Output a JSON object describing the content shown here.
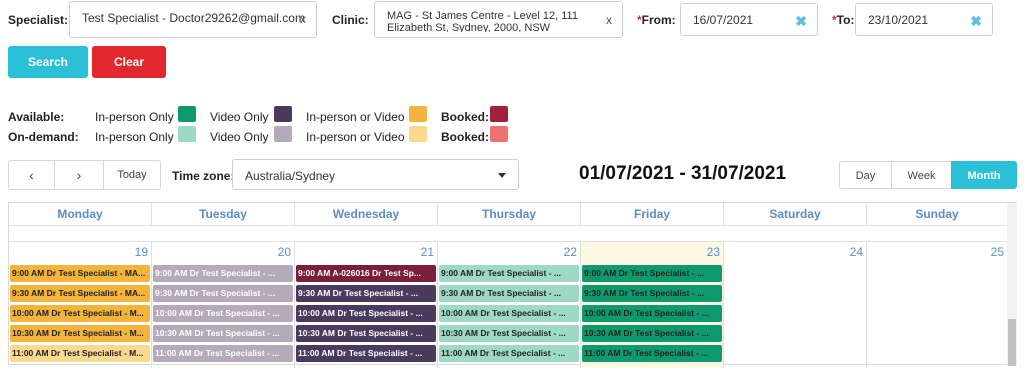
{
  "filters": {
    "specialist_label": "Specialist:",
    "specialist_value": "Test Specialist - Doctor29262@gmail.com",
    "clinic_label": "Clinic:",
    "clinic_value_line1": "MAG - St James Centre - Level 12, 111",
    "clinic_value_line2": "Elizabeth St, Sydney, 2000, NSW",
    "from_label": "From:",
    "from_value": "16/07/2021",
    "to_label": "To:",
    "to_value": "23/10/2021",
    "clear_x": "x",
    "clear_icon": "✖"
  },
  "actions": {
    "search_label": "Search",
    "clear_label": "Clear"
  },
  "legend": {
    "available_label": "Available:",
    "ondemand_label": "On-demand:",
    "inperson_only": "In-person Only",
    "video_only": "Video Only",
    "inperson_or_video": "In-person or Video",
    "booked": "Booked:",
    "colors": {
      "avail_inperson": "#0f9a6e",
      "avail_video": "#4a3b5e",
      "avail_either": "#f3b43c",
      "avail_booked": "#a1213a",
      "od_inperson": "#9ed9c6",
      "od_video": "#b4aab9",
      "od_either": "#fbd98e",
      "od_booked": "#f07070"
    }
  },
  "toolbar": {
    "prev": "‹",
    "next": "›",
    "today": "Today",
    "timezone_label": "Time zone:",
    "timezone_value": "Australia/Sydney",
    "range_title": "01/07/2021 - 31/07/2021",
    "views": [
      "Day",
      "Week",
      "Month"
    ],
    "active_view": "Month"
  },
  "calendar": {
    "weekdays": [
      "Monday",
      "Tuesday",
      "Wednesday",
      "Thursday",
      "Friday",
      "Saturday",
      "Sunday"
    ],
    "days": [
      "19",
      "20",
      "21",
      "22",
      "23",
      "24",
      "25"
    ],
    "events": {
      "mon": [
        "9:00 AM Dr Test Specialist - MA...",
        "9:30 AM Dr Test Specialist - MA...",
        "10:00 AM Dr Test Specialist - M...",
        "10:30 AM Dr Test Specialist - M...",
        "11:00 AM Dr Test Specialist - M..."
      ],
      "tue": [
        "9:00 AM Dr Test Specialist - ...",
        "9:30 AM Dr Test Specialist - ...",
        "10:00 AM Dr Test Specialist - ...",
        "10:30 AM Dr Test Specialist - ...",
        "11:00 AM Dr Test Specialist - ..."
      ],
      "wed": [
        "9:00 AM A-026016 Dr Test Sp...",
        "9:30 AM Dr Test Specialist - ...",
        "10:00 AM Dr Test Specialist - ...",
        "10:30 AM Dr Test Specialist - ...",
        "11:00 AM Dr Test Specialist - ..."
      ],
      "thu": [
        "9:00 AM Dr Test Specialist - ...",
        "9:30 AM Dr Test Specialist - ...",
        "10:00 AM Dr Test Specialist - ...",
        "10:30 AM Dr Test Specialist - ...",
        "11:00 AM Dr Test Specialist - ..."
      ],
      "fri": [
        "9:00 AM Dr Test Specialist - ...",
        "9:30 AM Dr Test Specialist - ...",
        "10:00 AM Dr Test Specialist - ...",
        "10:30 AM Dr Test Specialist - ...",
        "11:00 AM Dr Test Specialist - ..."
      ]
    }
  }
}
